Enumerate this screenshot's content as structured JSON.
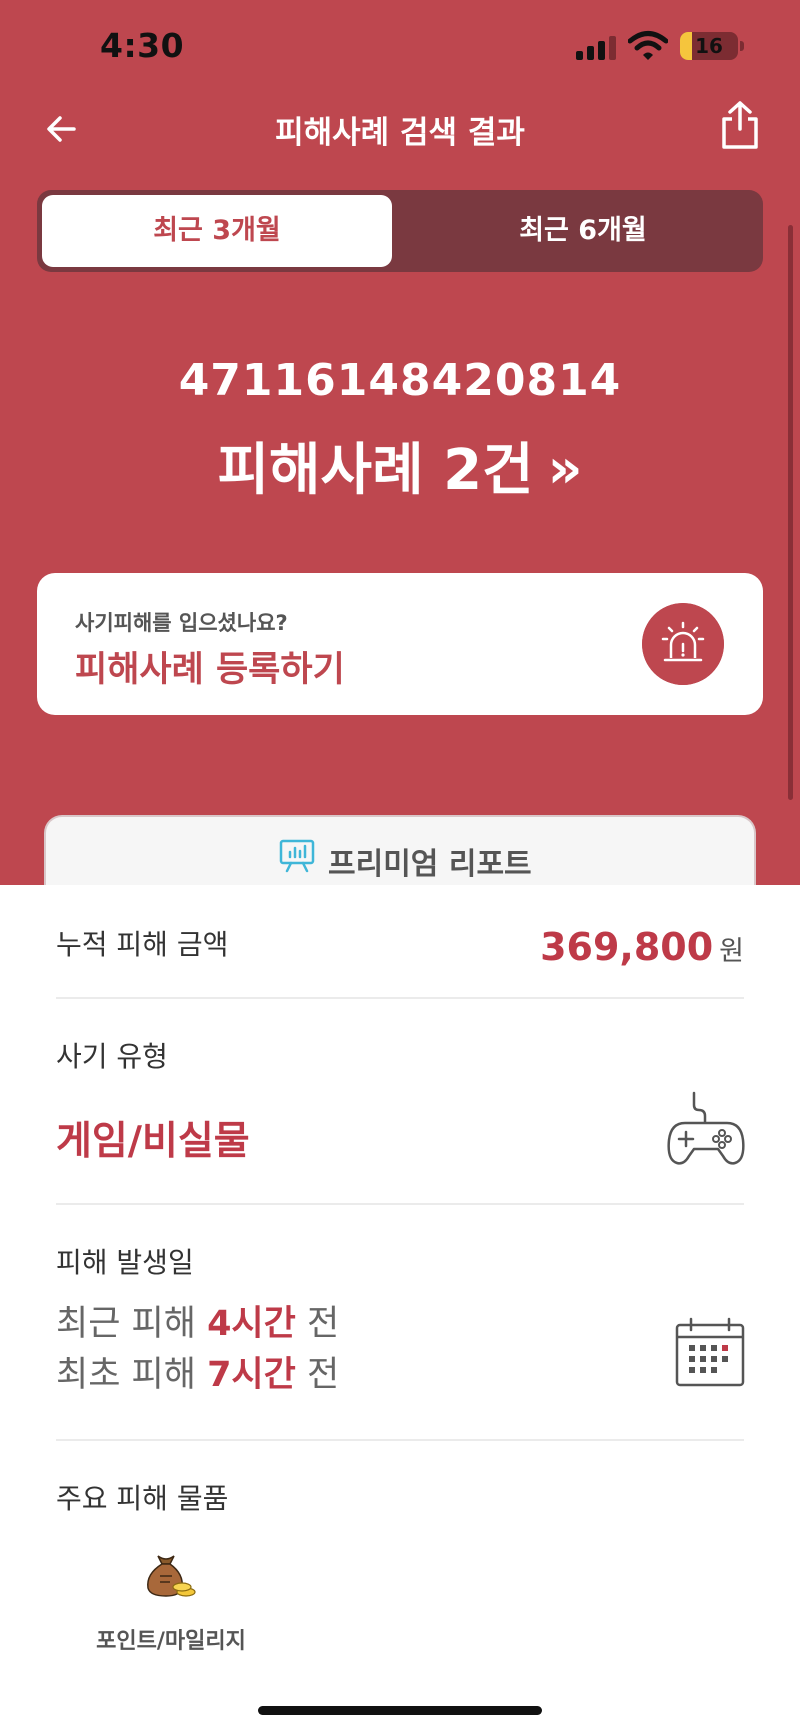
{
  "status_bar": {
    "time": "4:30",
    "battery": "16"
  },
  "header": {
    "title": "피해사례 검색 결과"
  },
  "tabs": [
    {
      "label": "최근 3개월",
      "active": true
    },
    {
      "label": "최근 6개월",
      "active": false
    }
  ],
  "hero": {
    "number": "47116148420814",
    "count_text": "피해사례 2건",
    "chevron": "»"
  },
  "report_card": {
    "question": "사기피해를 입으셨나요?",
    "cta": "피해사례 등록하기",
    "icon": "siren-icon"
  },
  "premium": {
    "label": "프리미엄 리포트",
    "icon": "chart-presentation-icon"
  },
  "cumulative": {
    "label": "누적 피해 금액",
    "value": "369,800",
    "unit": "원"
  },
  "fraud_type": {
    "label": "사기 유형",
    "value": "게임/비실물",
    "icon": "gamepad-icon"
  },
  "damage_date": {
    "label": "피해 발생일",
    "recent_prefix": "최근 피해",
    "recent_value": "4시간",
    "recent_suffix": "전",
    "first_prefix": "최초 피해",
    "first_value": "7시간",
    "first_suffix": "전",
    "icon": "calendar-icon"
  },
  "main_items": {
    "label": "주요 피해 물품",
    "items": [
      {
        "label": "포인트/마일리지",
        "icon": "money-bag-icon"
      }
    ]
  },
  "colors": {
    "accent": "#be474f",
    "accent_dark": "#7a3940",
    "highlight": "#be3a48"
  }
}
